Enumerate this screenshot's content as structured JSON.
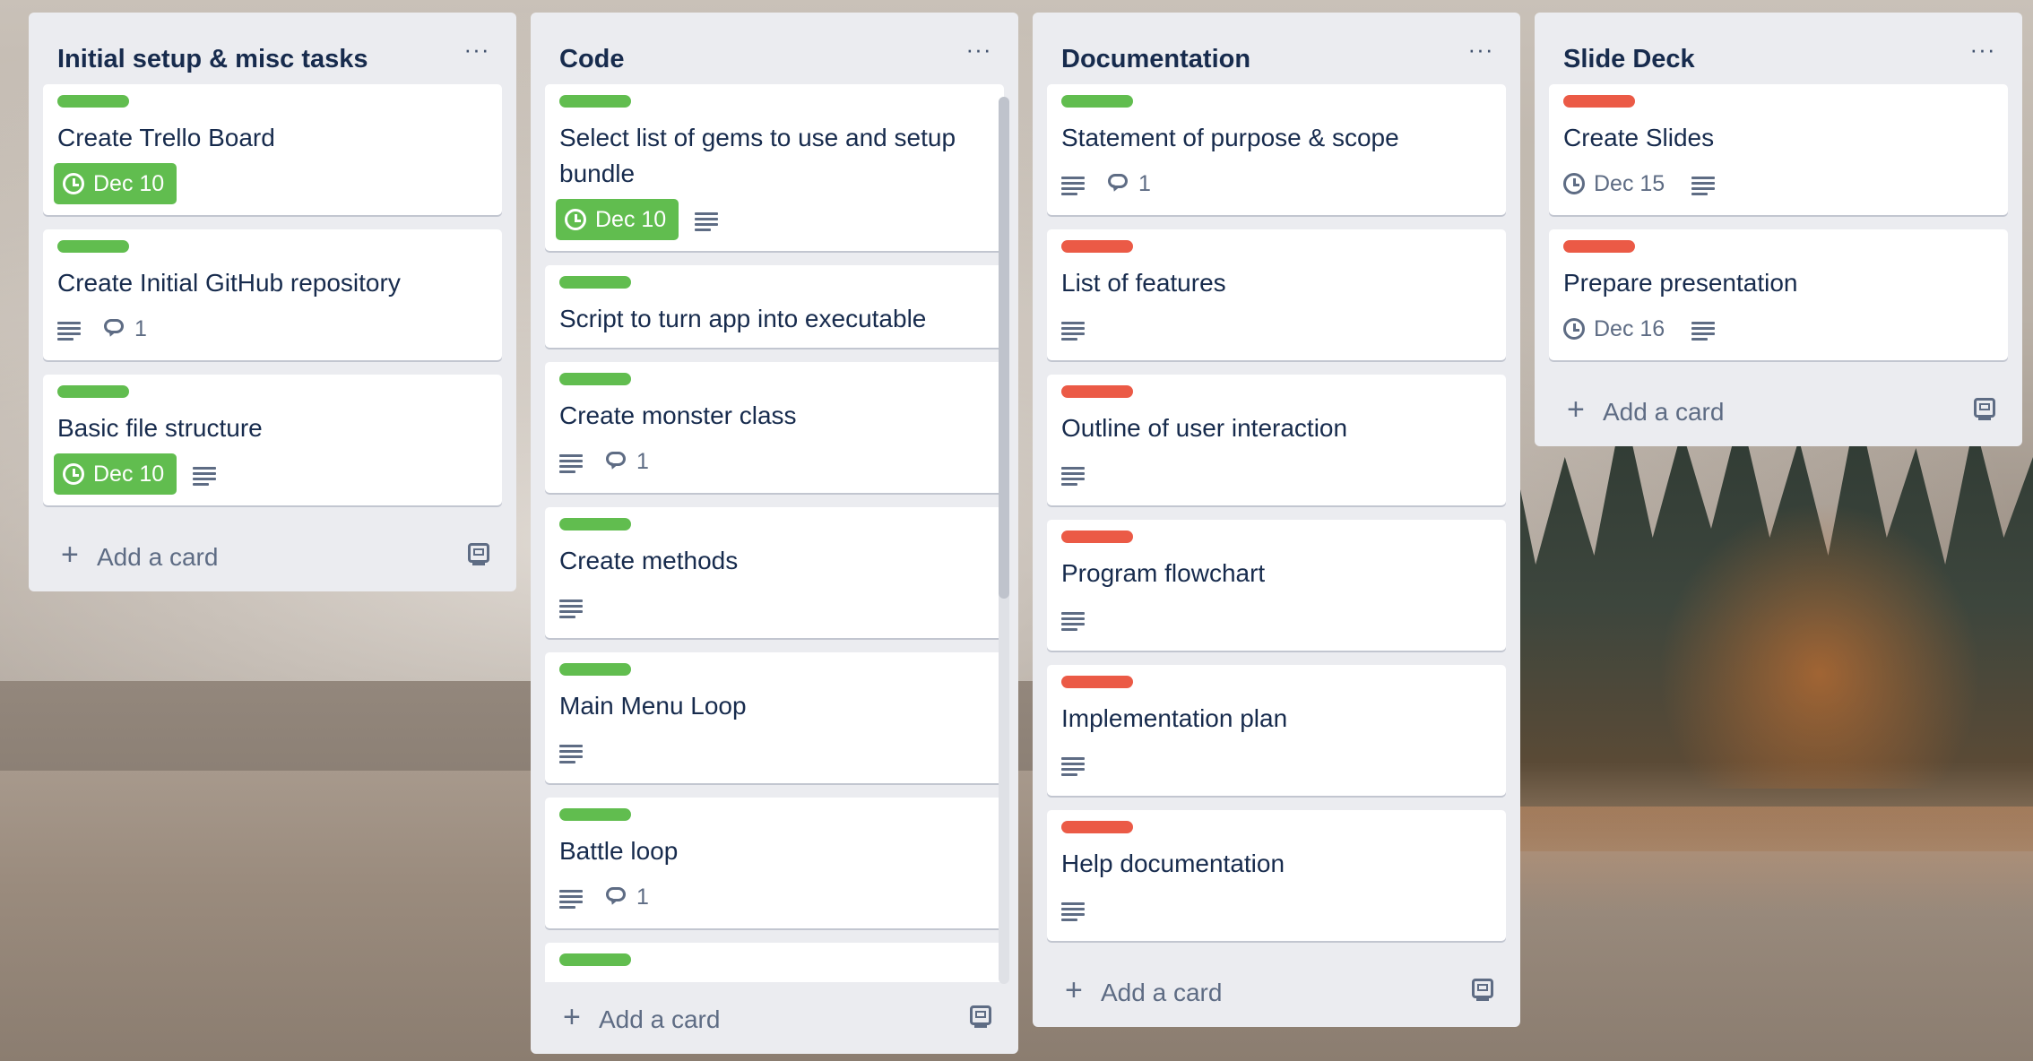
{
  "colors": {
    "green_label": "#61bd4f",
    "red_label": "#eb5a46",
    "list_bg": "#ebecf0",
    "text": "#172b4d",
    "muted": "#5e6c84"
  },
  "icons": {
    "menu": "more-horizontal-icon",
    "due": "clock-icon",
    "description": "description-icon",
    "comment": "comment-icon",
    "add": "plus-icon",
    "template": "card-template-icon"
  },
  "lists": [
    {
      "title": "Initial setup & misc tasks",
      "menu": "···",
      "add_label": "Add a card",
      "cards": [
        {
          "label": "green",
          "title": "Create Trello Board",
          "due": "Dec 10",
          "due_style": "green",
          "desc": false,
          "comments": ""
        },
        {
          "label": "green",
          "title": "Create Initial GitHub repository",
          "due": "",
          "desc": true,
          "comments": "1"
        },
        {
          "label": "green",
          "title": "Basic file structure",
          "due": "Dec 10",
          "due_style": "green",
          "desc": true,
          "comments": ""
        }
      ]
    },
    {
      "title": "Code",
      "menu": "···",
      "add_label": "Add a card",
      "cards": [
        {
          "label": "green",
          "title": "Select list of gems to use and setup bundle",
          "due": "Dec 10",
          "due_style": "green",
          "desc": true,
          "comments": ""
        },
        {
          "label": "green",
          "title": "Script to turn app into executable",
          "due": "",
          "desc": false,
          "comments": ""
        },
        {
          "label": "green",
          "title": "Create monster class",
          "due": "",
          "desc": true,
          "comments": "1"
        },
        {
          "label": "green",
          "title": "Create methods",
          "due": "",
          "desc": true,
          "comments": ""
        },
        {
          "label": "green",
          "title": "Main Menu Loop",
          "due": "",
          "desc": true,
          "comments": ""
        },
        {
          "label": "green",
          "title": "Battle loop",
          "due": "",
          "desc": true,
          "comments": "1"
        },
        {
          "label": "green",
          "title": "",
          "due": "",
          "desc": false,
          "comments": ""
        }
      ]
    },
    {
      "title": "Documentation",
      "menu": "···",
      "add_label": "Add a card",
      "cards": [
        {
          "label": "green",
          "title": "Statement of purpose & scope",
          "due": "",
          "desc": true,
          "comments": "1"
        },
        {
          "label": "red",
          "title": "List of features",
          "due": "",
          "desc": true,
          "comments": ""
        },
        {
          "label": "red",
          "title": "Outline of user interaction",
          "due": "",
          "desc": true,
          "comments": ""
        },
        {
          "label": "red",
          "title": "Program flowchart",
          "due": "",
          "desc": true,
          "comments": ""
        },
        {
          "label": "red",
          "title": "Implementation plan",
          "due": "",
          "desc": true,
          "comments": ""
        },
        {
          "label": "red",
          "title": "Help documentation",
          "due": "",
          "desc": true,
          "comments": ""
        }
      ]
    },
    {
      "title": "Slide Deck",
      "menu": "···",
      "add_label": "Add a card",
      "cards": [
        {
          "label": "red",
          "title": "Create Slides",
          "due": "Dec 15",
          "due_style": "plain",
          "desc": true,
          "comments": ""
        },
        {
          "label": "red",
          "title": "Prepare presentation",
          "due": "Dec 16",
          "due_style": "plain",
          "desc": true,
          "comments": ""
        }
      ]
    }
  ]
}
